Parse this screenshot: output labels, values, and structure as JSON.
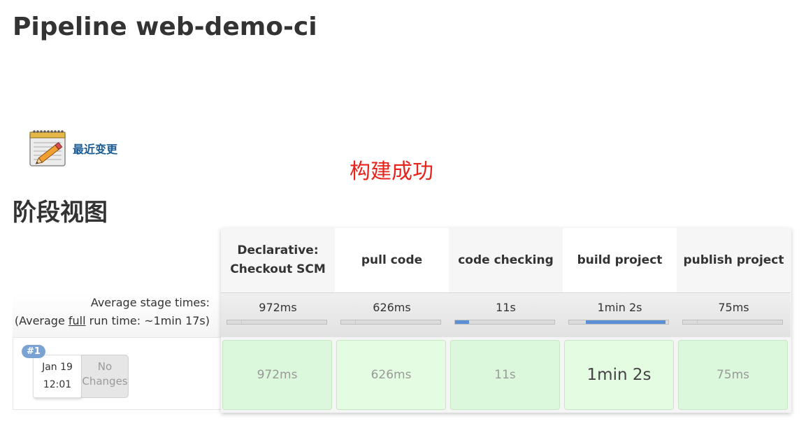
{
  "page": {
    "title": "Pipeline web-demo-ci"
  },
  "changes": {
    "label": "最近变更",
    "icon": "notepad-pencil-icon"
  },
  "status_text": "构建成功",
  "stage_view": {
    "title": "阶段视图",
    "avg_label": {
      "line1": "Average stage times:",
      "line2_prefix": "(Average ",
      "line2_link": "full",
      "line2_suffix": " run time: ~1min 17s)"
    },
    "stages": [
      {
        "name": "Declarative: Checkout SCM",
        "avg": "972ms",
        "avg_fraction": 0.01,
        "run_time": "972ms",
        "header_bg": "#f6f6f6",
        "cell_bg": "#dcf8dc"
      },
      {
        "name": "pull code",
        "avg": "626ms",
        "avg_fraction": 0.01,
        "run_time": "626ms",
        "header_bg": "#ffffff",
        "cell_bg": "#e4fde2"
      },
      {
        "name": "code checking",
        "avg": "11s",
        "avg_fraction": 0.14,
        "run_time": "11s",
        "header_bg": "#f6f6f6",
        "cell_bg": "#dcf8dc"
      },
      {
        "name": "build project",
        "avg": "1min 2s",
        "avg_fraction": 0.8,
        "run_time": "1min 2s",
        "header_bg": "#ffffff",
        "cell_bg": "#e4fde2"
      },
      {
        "name": "publish project",
        "avg": "75ms",
        "avg_fraction": 0.01,
        "run_time": "75ms",
        "header_bg": "#f6f6f6",
        "cell_bg": "#dcf8dc"
      }
    ],
    "build": {
      "number": "#1",
      "date": "Jan 19",
      "time": "12:01",
      "changes": "No Changes"
    }
  },
  "colors": {
    "accent_link": "#1a5c93",
    "status_success": "#e8231c",
    "progress": "#5b8fd6"
  }
}
